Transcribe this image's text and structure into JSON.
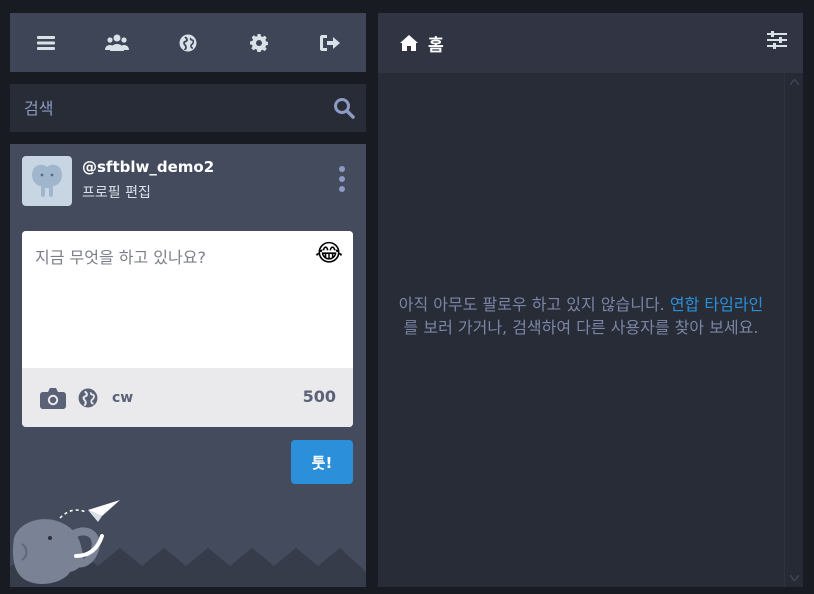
{
  "nav": {
    "menu_icon": "bars-icon",
    "people_icon": "users-icon",
    "globe_icon": "globe-icon",
    "settings_icon": "gear-icon",
    "logout_icon": "sign-out-icon"
  },
  "search": {
    "placeholder": "검색"
  },
  "account": {
    "handle": "@sftblw_demo2",
    "edit_label": "프로필 편집"
  },
  "compose": {
    "placeholder": "지금 무엇을 하고 있나요?",
    "emoji": "😂",
    "cw_label": "cw",
    "char_count": "500",
    "toot_label": "툿!"
  },
  "column": {
    "title": "홈",
    "empty_before": "아직 아무도 팔로우 하고 있지 않습니다. ",
    "empty_link": "연합 타임라인",
    "empty_after": "를 보러 가거나, 검색하여 다른 사용자를 찾아 보세요."
  },
  "colors": {
    "accent": "#2b90d9",
    "background": "#191b22",
    "panel": "#282c37",
    "header": "#3d4556"
  }
}
